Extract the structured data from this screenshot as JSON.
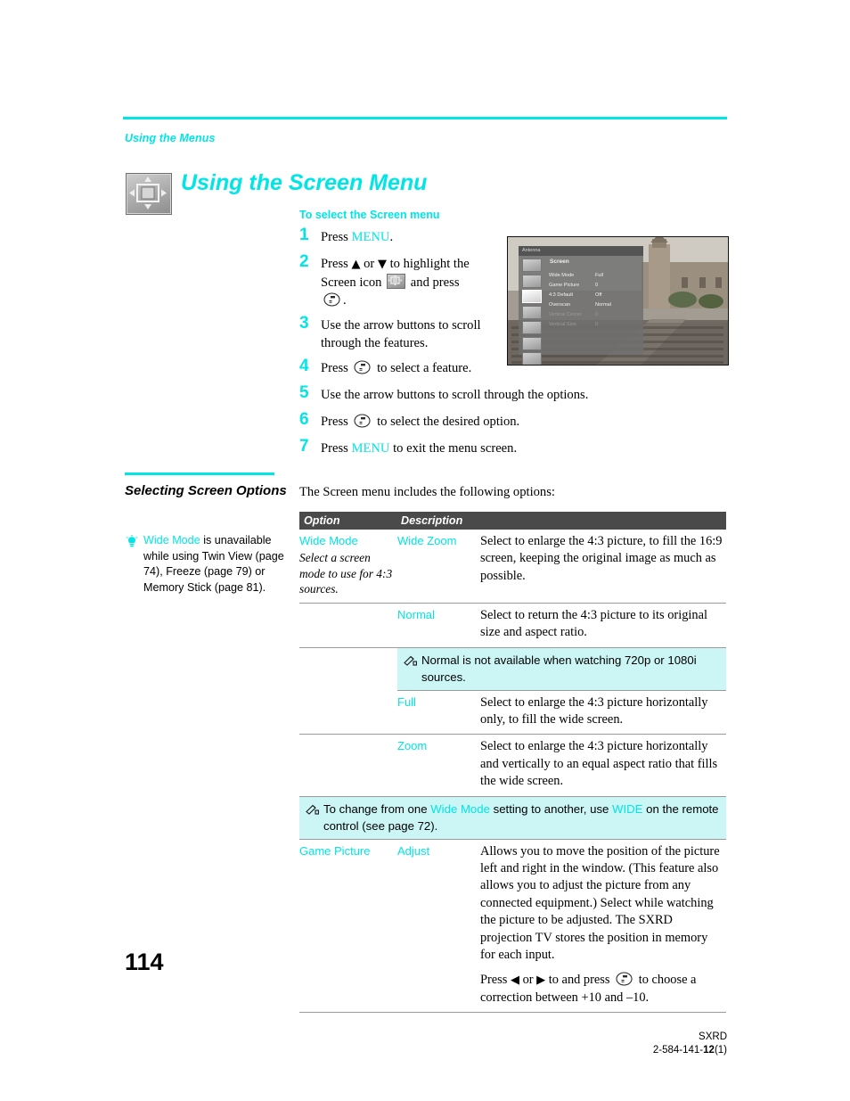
{
  "running_head": "Using the Menus",
  "chapter": {
    "title": "Using the Screen Menu",
    "icon": "screen-menu-icon",
    "accent_color": "#00e5e5"
  },
  "procedure": {
    "heading": "To select the Screen menu",
    "steps": [
      {
        "num": "1",
        "text_before": "Press ",
        "keyword": "MENU",
        "text_after": "."
      },
      {
        "num": "2",
        "line1_a": "Press ",
        "arrow_up": "♦",
        "line1_b": " or ",
        "arrow_down": "♦",
        "line1_c": " to highlight the",
        "line2_a": "Screen icon ",
        "icon": "screen-menu-icon",
        "line2_b": " and press",
        "line3": "."
      },
      {
        "num": "3",
        "text": "Use the arrow buttons to scroll through the features."
      },
      {
        "num": "4",
        "text_before": "Press ",
        "button": "select-button",
        "text_after": " to select a feature."
      },
      {
        "num": "5",
        "text": "Use the arrow buttons to scroll through the options."
      },
      {
        "num": "6",
        "text_before": "Press ",
        "button": "select-button",
        "text_after": " to select the desired option."
      },
      {
        "num": "7",
        "text_before": "Press ",
        "keyword": "MENU",
        "text_after": " to exit the menu screen."
      }
    ]
  },
  "tv_screenshot": {
    "input_label": "Antenna",
    "menu_title": "Screen",
    "rows": [
      {
        "label": "Wide Mode",
        "value": "Full",
        "dim": false
      },
      {
        "label": "Game Picture",
        "value": "0",
        "dim": false
      },
      {
        "label": "4:3 Default",
        "value": "Off",
        "dim": false
      },
      {
        "label": "Overscan",
        "value": "Normal",
        "dim": false
      },
      {
        "label": "Vertical Center",
        "value": "0",
        "dim": true
      },
      {
        "label": "Vertical Size",
        "value": "0",
        "dim": true
      }
    ]
  },
  "sidebar": {
    "heading": "Selecting Screen Options",
    "tip_icon": "lightbulb-icon",
    "tip_keyword": "Wide Mode",
    "tip_text": " is unavailable while using Twin View (page 74), Freeze (page 79) or Memory Stick (page 81)."
  },
  "main": {
    "intro": "The Screen menu includes the following options:"
  },
  "table": {
    "headers": {
      "option": "Option",
      "description": "Description"
    },
    "rows": [
      {
        "kind": "row",
        "option": "Wide Mode",
        "option_sub": "Select a screen mode to use for 4:3 sources.",
        "value": "Wide Zoom",
        "description": "Select to enlarge the 4:3 picture, to fill the 16:9 screen, keeping the original image as much as possible."
      },
      {
        "kind": "row",
        "option": "",
        "option_sub": "",
        "value": "Normal",
        "description": "Select to return the 4:3 picture to its original size and aspect ratio."
      },
      {
        "kind": "note-indent",
        "icon": "note-pen-icon",
        "text": "Normal is not available when watching 720p or 1080i sources."
      },
      {
        "kind": "row",
        "option": "",
        "option_sub": "",
        "value": "Full",
        "description": "Select to enlarge the 4:3 picture horizontally only, to fill the wide screen."
      },
      {
        "kind": "row",
        "option": "",
        "option_sub": "",
        "value": "Zoom",
        "description": "Select to enlarge the 4:3 picture horizontally and vertically to an equal aspect ratio that fills the wide screen."
      },
      {
        "kind": "note-full",
        "icon": "note-pen-icon",
        "text_a": "To change from one ",
        "kw_a": "Wide Mode",
        "text_b": " setting to another, use ",
        "kw_b": "WIDE",
        "text_c": " on the remote control (see page 72)."
      },
      {
        "kind": "row-game",
        "option": "Game Picture",
        "option_sub": "",
        "value": "Adjust",
        "description_p1": "Allows you to move the position of the picture left and right in the window. (This feature also allows you to adjust the picture from any connected equipment.) Select while watching the picture to be adjusted. The SXRD projection TV stores the position in memory for each input.",
        "p2_a": "Press ",
        "p2_arrow_left": "♦",
        "p2_b": " or ",
        "p2_arrow_right": "♦",
        "p2_c": " to and press ",
        "p2_button": "select-button",
        "p2_d": " to choose a correction between +10 and –10."
      }
    ]
  },
  "folio": "114",
  "footer": {
    "line1": "SXRD",
    "line2_prefix": "2-584-141-",
    "line2_bold": "12",
    "line2_suffix": "(1)"
  }
}
